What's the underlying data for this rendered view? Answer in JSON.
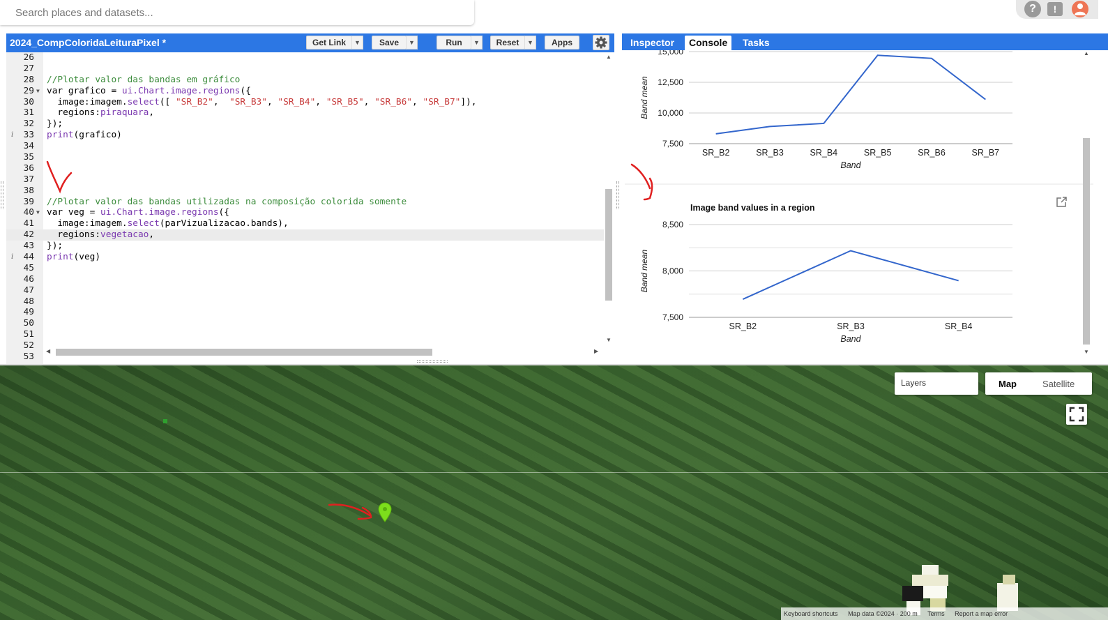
{
  "search": {
    "placeholder": "Search places and datasets..."
  },
  "topbar": {
    "help_icon": "help-icon",
    "feedback_icon": "feedback-icon",
    "avatar_icon": "account-icon"
  },
  "editor": {
    "title": "2024_CompColoridaLeituraPixel *",
    "buttons": {
      "get_link": "Get Link",
      "save": "Save",
      "run": "Run",
      "reset": "Reset",
      "apps": "Apps"
    },
    "lines": [
      {
        "n": "26",
        "text": ""
      },
      {
        "n": "27",
        "text": ""
      },
      {
        "n": "28",
        "text": "//Plotar valor das bandas em gráfico"
      },
      {
        "n": "29",
        "text": "var grafico = ui.Chart.image.regions({"
      },
      {
        "n": "30",
        "text": "  image:imagem.select([ \"SR_B2\",  \"SR_B3\", \"SR_B4\", \"SR_B5\", \"SR_B6\", \"SR_B7\"]),"
      },
      {
        "n": "31",
        "text": "  regions:piraquara,"
      },
      {
        "n": "32",
        "text": "});"
      },
      {
        "n": "33",
        "text": "print(grafico)"
      },
      {
        "n": "34",
        "text": ""
      },
      {
        "n": "35",
        "text": ""
      },
      {
        "n": "36",
        "text": ""
      },
      {
        "n": "37",
        "text": ""
      },
      {
        "n": "38",
        "text": ""
      },
      {
        "n": "39",
        "text": "//Plotar valor das bandas utilizadas na composição colorida somente"
      },
      {
        "n": "40",
        "text": "var veg = ui.Chart.image.regions({"
      },
      {
        "n": "41",
        "text": "  image:imagem.select(parVizualizacao.bands),"
      },
      {
        "n": "42",
        "text": "  regions:vegetacao,"
      },
      {
        "n": "43",
        "text": "});"
      },
      {
        "n": "44",
        "text": "print(veg)"
      },
      {
        "n": "45",
        "text": ""
      },
      {
        "n": "46",
        "text": ""
      },
      {
        "n": "47",
        "text": ""
      },
      {
        "n": "48",
        "text": ""
      },
      {
        "n": "49",
        "text": ""
      },
      {
        "n": "50",
        "text": ""
      },
      {
        "n": "51",
        "text": ""
      },
      {
        "n": "52",
        "text": ""
      },
      {
        "n": "53",
        "text": ""
      }
    ]
  },
  "right_panel": {
    "tabs": {
      "inspector": "Inspector",
      "console": "Console",
      "tasks": "Tasks"
    }
  },
  "chart_data": [
    {
      "type": "line",
      "title": "",
      "categories": [
        "SR_B2",
        "SR_B3",
        "SR_B4",
        "SR_B5",
        "SR_B6",
        "SR_B7"
      ],
      "values": [
        8300,
        8900,
        9150,
        14700,
        14450,
        11100
      ],
      "xlabel": "Band",
      "ylabel": "Band mean",
      "yticks": [
        "7,500",
        "10,000",
        "12,500",
        "15,000"
      ],
      "ylim": [
        7500,
        15000
      ],
      "color": "#3366cc"
    },
    {
      "type": "line",
      "title": "Image band values in a region",
      "categories": [
        "SR_B2",
        "SR_B3",
        "SR_B4"
      ],
      "values": [
        7695,
        8218,
        7895
      ],
      "xlabel": "Band",
      "ylabel": "Band mean",
      "yticks": [
        "7,500",
        "8,000",
        "8,500"
      ],
      "ylim": [
        7500,
        8500
      ],
      "color": "#3366cc"
    }
  ],
  "map": {
    "layers_label": "Layers",
    "map_label": "Map",
    "satellite_label": "Satellite",
    "attribution": [
      "Keyboard shortcuts",
      "Map data ©2024 · 200 m",
      "Terms",
      "Report a map error"
    ]
  }
}
